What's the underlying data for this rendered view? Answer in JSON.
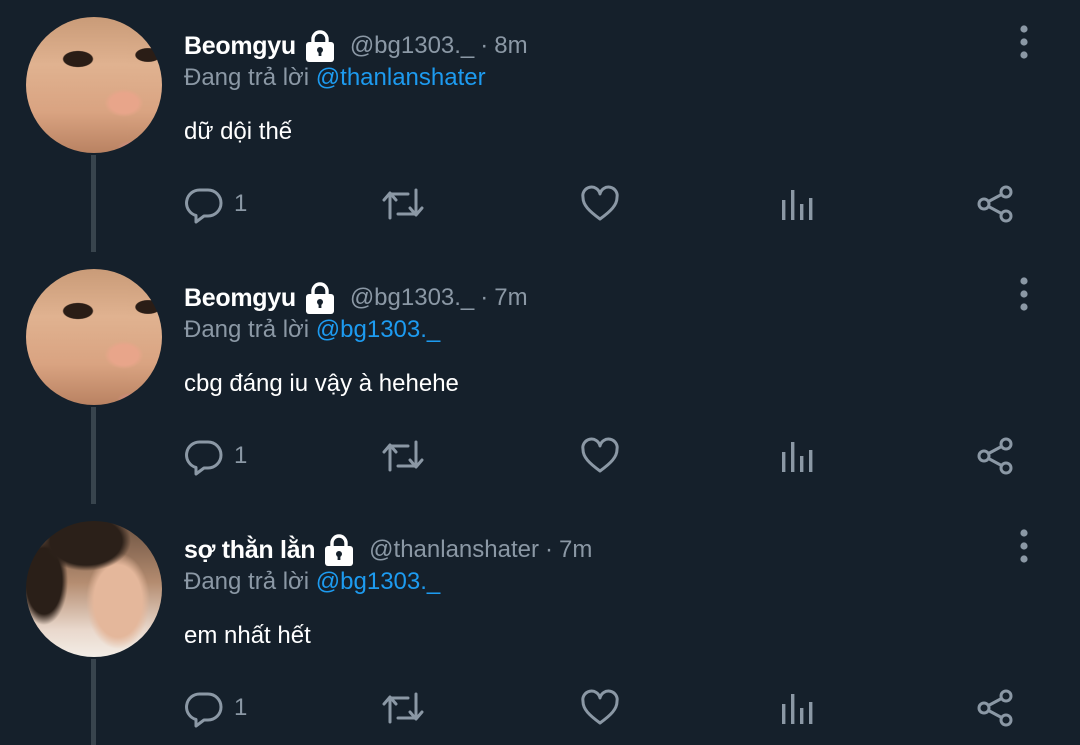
{
  "colors": {
    "background": "#15202b",
    "primary_text": "#ffffff",
    "secondary_text": "#8b98a5",
    "mention": "#1d9bf0",
    "thread_line": "#38444d"
  },
  "reply_prefix": "Đang trả lời",
  "tweets": [
    {
      "name": "Beomgyu",
      "protected_icon": "lock-icon",
      "handle": "@bg1303._",
      "separator": "·",
      "time": "8m",
      "reply_to": "@thanlanshater",
      "text": "dữ dội thế",
      "reply_count": "1"
    },
    {
      "name": "Beomgyu",
      "protected_icon": "lock-icon",
      "handle": "@bg1303._",
      "separator": "·",
      "time": "7m",
      "reply_to": "@bg1303._",
      "text": "cbg đáng iu vậy à hehehe",
      "reply_count": "1"
    },
    {
      "name": "sợ thằn lằn",
      "protected_icon": "lock-icon",
      "handle": "@thanlanshater",
      "separator": "·",
      "time": "7m",
      "reply_to": "@bg1303._",
      "text": "em nhất hết",
      "reply_count": "1"
    }
  ],
  "action_icons": [
    "reply-icon",
    "retweet-icon",
    "like-icon",
    "analytics-icon",
    "share-icon"
  ]
}
